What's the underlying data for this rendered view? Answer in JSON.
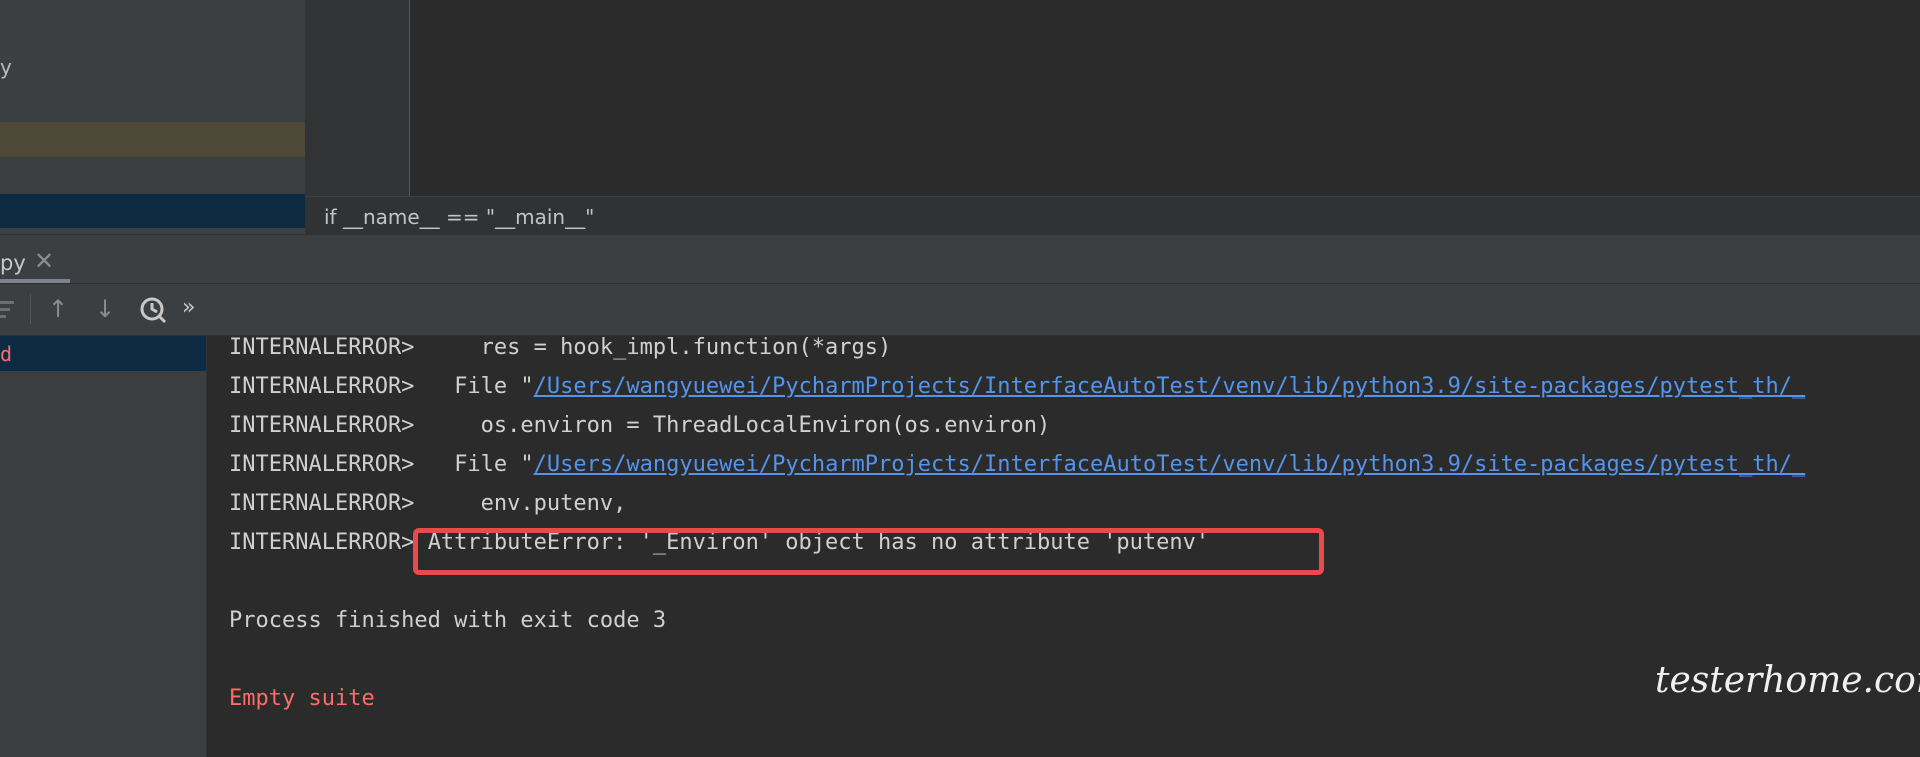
{
  "project": {
    "partial_item": "y"
  },
  "editor": {
    "breadcrumb": "if __name__ == \"__main__\""
  },
  "run": {
    "tab_label": "py",
    "tab_close_glyph": "✕",
    "toolbar": {
      "sort_icon": "sort-icon",
      "up_icon": "arrow-up-icon",
      "down_icon": "arrow-down-icon",
      "history_icon": "history-icon",
      "more_icon": "more-chevrons-icon",
      "up_glyph": "↑",
      "down_glyph": "↓",
      "more_glyph": "»"
    },
    "tree_label": "d"
  },
  "console": {
    "prefix": "INTERNALERROR>",
    "lines": [
      {
        "indent": "     ",
        "text": "res = hook_impl.function(*args)"
      },
      {
        "indent": "   ",
        "text_before": "File \"",
        "link": "/Users/wangyuewei/PycharmProjects/InterfaceAutoTest/venv/lib/python3.9/site-packages/pytest_th/_"
      },
      {
        "indent": "     ",
        "text": "os.environ = ThreadLocalEnviron(os.environ)"
      },
      {
        "indent": "   ",
        "text_before": "File \"",
        "link": "/Users/wangyuewei/PycharmProjects/InterfaceAutoTest/venv/lib/python3.9/site-packages/pytest_th/_"
      },
      {
        "indent": "     ",
        "text": "env.putenv,"
      },
      {
        "indent": " ",
        "text": "AttributeError: '_Environ' object has no attribute 'putenv'"
      }
    ],
    "process_finished": "Process finished with exit code 3",
    "empty_suite": "Empty suite"
  },
  "watermark": "testerhome.com",
  "colors": {
    "error_box": "#ea4a4a",
    "link": "#5394ec",
    "error_text": "#ff6b68"
  }
}
